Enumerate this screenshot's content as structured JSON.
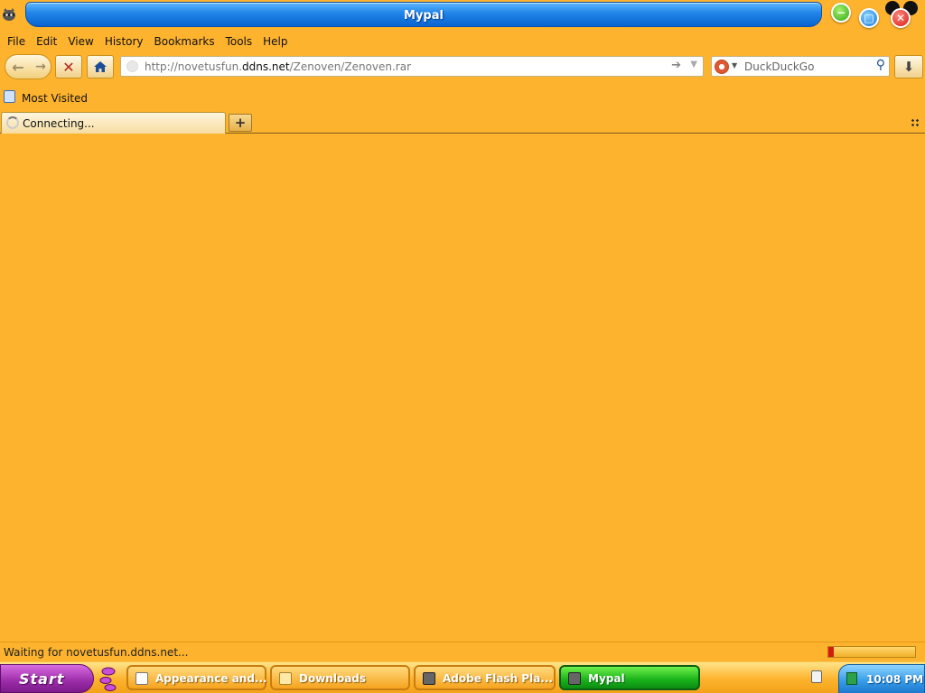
{
  "window": {
    "title": "Mypal",
    "app_icon": "raccoon-icon",
    "caption_buttons": [
      "minimize-icon",
      "maximize-icon",
      "close-icon"
    ]
  },
  "menu": {
    "items": [
      "File",
      "Edit",
      "View",
      "History",
      "Bookmarks",
      "Tools",
      "Help"
    ]
  },
  "navbar": {
    "back_icon": "back-arrow-icon",
    "forward_icon": "forward-arrow-icon",
    "stop_icon": "stop-icon",
    "home_icon": "home-icon",
    "url_prefix": "http://novetusfun.",
    "url_host": "ddns.net",
    "url_path": "/Zenoven/Zenoven.rar",
    "search_placeholder": "DuckDuckGo",
    "search_engine_icon": "duckduckgo-icon",
    "download_icon": "download-arrow-icon"
  },
  "bookmarks": {
    "items": [
      "Most Visited"
    ]
  },
  "tabs": {
    "items": [
      {
        "label": "Connecting...",
        "loading": true
      }
    ],
    "new_tab_label": "+"
  },
  "status": {
    "text": "Waiting for novetusfun.ddns.net...",
    "progress_fraction": 0.06
  },
  "taskbar": {
    "start_label": "Start",
    "tasks": [
      {
        "label": "Appearance and...",
        "active": false
      },
      {
        "label": "Downloads",
        "active": false
      },
      {
        "label": "Adobe Flash Pla...",
        "active": false
      },
      {
        "label": "Mypal",
        "active": true
      }
    ],
    "clock": "10:08 PM"
  },
  "colors": {
    "theme_orange": "#fdb32e",
    "title_blue": "#1f84e8",
    "start_purple": "#9b2ca8",
    "active_task_green": "#19b31a"
  }
}
